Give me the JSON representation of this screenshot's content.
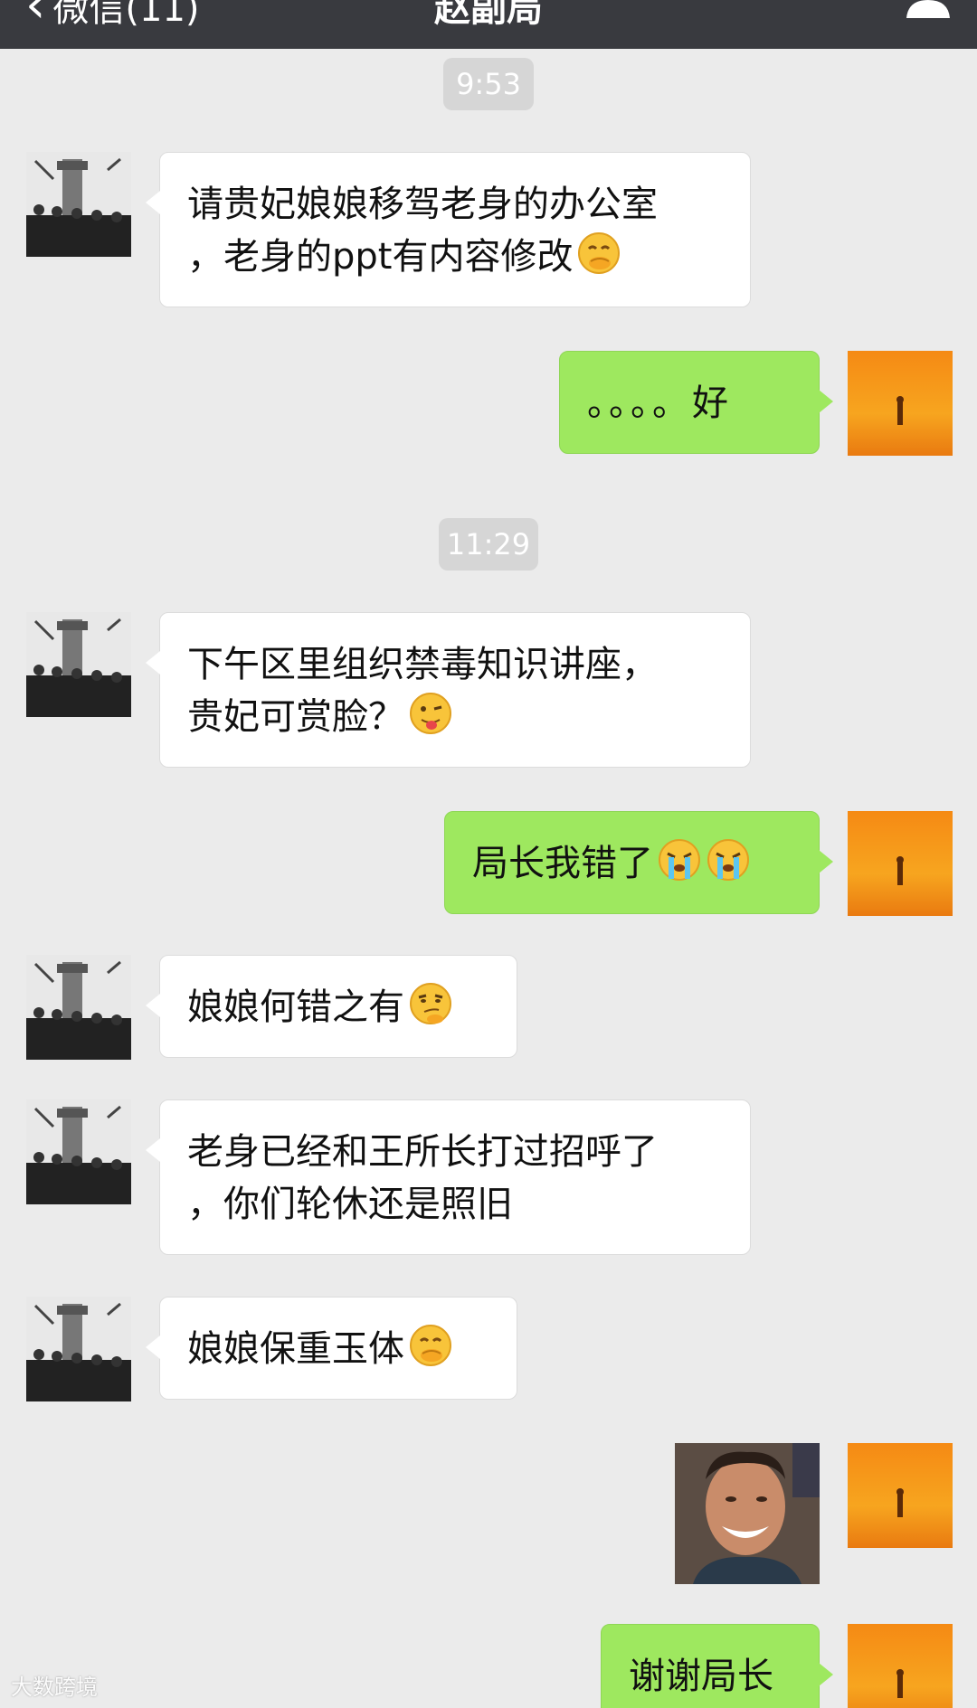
{
  "navbar": {
    "back_label": "微信(11)",
    "title": "赵副局"
  },
  "messages": [
    {
      "type": "time",
      "text": "9:53"
    },
    {
      "type": "in",
      "lines": [
        "请贵妃娘娘移驾老身的办公室",
        "，老身的ppt有内容修改"
      ],
      "emoji": "face-with-hand-over-mouth-icon"
    },
    {
      "type": "out",
      "lines": [
        "。。。。好"
      ]
    },
    {
      "type": "time",
      "text": "11:29"
    },
    {
      "type": "in",
      "lines": [
        "下午区里组织禁毒知识讲座，",
        "贵妃可赏脸？"
      ],
      "emoji": "winking-tongue-face-icon"
    },
    {
      "type": "out",
      "lines": [
        "局长我错了"
      ],
      "emoji": "crying-face-icon"
    },
    {
      "type": "in",
      "lines": [
        "娘娘何错之有"
      ],
      "emoji": "smirking-face-icon"
    },
    {
      "type": "in",
      "lines": [
        "老身已经和王所长打过招呼了",
        "，你们轮休还是照旧"
      ]
    },
    {
      "type": "in",
      "lines": [
        "娘娘保重玉体"
      ],
      "emoji": "face-with-hand-over-mouth-icon"
    },
    {
      "type": "out-image",
      "description": "smiling man photo"
    },
    {
      "type": "out",
      "lines": [
        "谢谢局长"
      ]
    }
  ],
  "watermark": "大数跨境",
  "colors": {
    "navbar": "#393a3f",
    "background": "#ebebeb",
    "incoming_bubble": "#ffffff",
    "outgoing_bubble": "#9ee85f",
    "time_pill": "#d6d6d6"
  }
}
